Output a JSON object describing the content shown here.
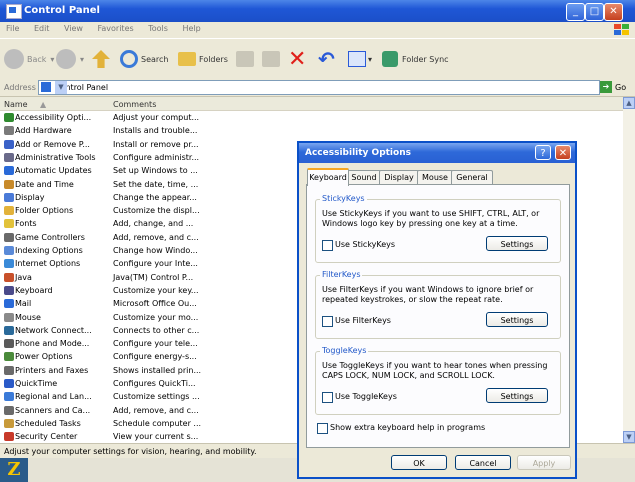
{
  "window": {
    "title": "Control Panel"
  },
  "menu": [
    "File",
    "Edit",
    "View",
    "Favorites",
    "Tools",
    "Help"
  ],
  "toolbar": {
    "back": "Back",
    "search": "Search",
    "folders": "Folders",
    "folder_sync": "Folder Sync"
  },
  "address": {
    "label": "Address",
    "value": "Control Panel",
    "go": "Go"
  },
  "list": {
    "columns": [
      "Name",
      "Comments"
    ],
    "rows": [
      {
        "name": "Accessibility Opti...",
        "comment": "Adjust your comput..."
      },
      {
        "name": "Add Hardware",
        "comment": "Installs and trouble..."
      },
      {
        "name": "Add or Remove P...",
        "comment": "Install or remove pr..."
      },
      {
        "name": "Administrative Tools",
        "comment": "Configure administr..."
      },
      {
        "name": "Automatic Updates",
        "comment": "Set up Windows to ..."
      },
      {
        "name": "Date and Time",
        "comment": "Set the date, time, ..."
      },
      {
        "name": "Display",
        "comment": "Change the appear..."
      },
      {
        "name": "Folder Options",
        "comment": "Customize the displ..."
      },
      {
        "name": "Fonts",
        "comment": "Add, change, and ..."
      },
      {
        "name": "Game Controllers",
        "comment": "Add, remove, and c..."
      },
      {
        "name": "Indexing Options",
        "comment": "Change how Windo..."
      },
      {
        "name": "Internet Options",
        "comment": "Configure your Inte..."
      },
      {
        "name": "Java",
        "comment": "Java(TM) Control P..."
      },
      {
        "name": "Keyboard",
        "comment": "Customize your key..."
      },
      {
        "name": "Mail",
        "comment": "Microsoft Office Ou..."
      },
      {
        "name": "Mouse",
        "comment": "Customize your mo..."
      },
      {
        "name": "Network Connect...",
        "comment": "Connects to other c..."
      },
      {
        "name": "Phone and Mode...",
        "comment": "Configure your tele..."
      },
      {
        "name": "Power Options",
        "comment": "Configure energy-s..."
      },
      {
        "name": "Printers and Faxes",
        "comment": "Shows installed prin..."
      },
      {
        "name": "QuickTime",
        "comment": "Configures QuickTi..."
      },
      {
        "name": "Regional and Lan...",
        "comment": "Customize settings ..."
      },
      {
        "name": "Scanners and Ca...",
        "comment": "Add, remove, and c..."
      },
      {
        "name": "Scheduled Tasks",
        "comment": "Schedule computer ..."
      },
      {
        "name": "Security Center",
        "comment": "View your current s..."
      }
    ],
    "icon_colors": [
      "#2f8a2f",
      "#7a7a7a",
      "#3a62c8",
      "#6a6a8a",
      "#2a6ad8",
      "#c88a2a",
      "#4a7ad8",
      "#e2b23a",
      "#e2c23a",
      "#6a6a6a",
      "#5a8ad8",
      "#3a8ad8",
      "#c8502a",
      "#4a4a8a",
      "#2a6ad8",
      "#8a8a8a",
      "#2a6a9a",
      "#5a5a5a",
      "#4a8a3a",
      "#6a6a6a",
      "#2a5ac8",
      "#3a7ad8",
      "#6a6a6a",
      "#c89a3a",
      "#c83a2a"
    ]
  },
  "status": "Adjust your computer settings for vision, hearing, and mobility.",
  "dialog": {
    "title": "Accessibility Options",
    "help": "?",
    "close": "✕",
    "tabs": [
      "Keyboard",
      "Sound",
      "Display",
      "Mouse",
      "General"
    ],
    "stickykeys": {
      "title": "StickyKeys",
      "desc": "Use StickyKeys if you want to use SHIFT, CTRL, ALT, or Windows logo key by pressing one key at a time.",
      "checkbox": "Use StickyKeys",
      "button": "Settings"
    },
    "filterkeys": {
      "title": "FilterKeys",
      "desc": "Use FilterKeys if you want Windows to ignore brief or repeated keystrokes, or slow the repeat rate.",
      "checkbox": "Use FilterKeys",
      "button": "Settings"
    },
    "togglekeys": {
      "title": "ToggleKeys",
      "desc": "Use ToggleKeys if you want to hear tones when pressing CAPS LOCK, NUM LOCK, and SCROLL LOCK.",
      "checkbox": "Use ToggleKeys",
      "button": "Settings"
    },
    "extra_help": "Show extra keyboard help in programs",
    "ok": "OK",
    "cancel": "Cancel",
    "apply": "Apply"
  }
}
